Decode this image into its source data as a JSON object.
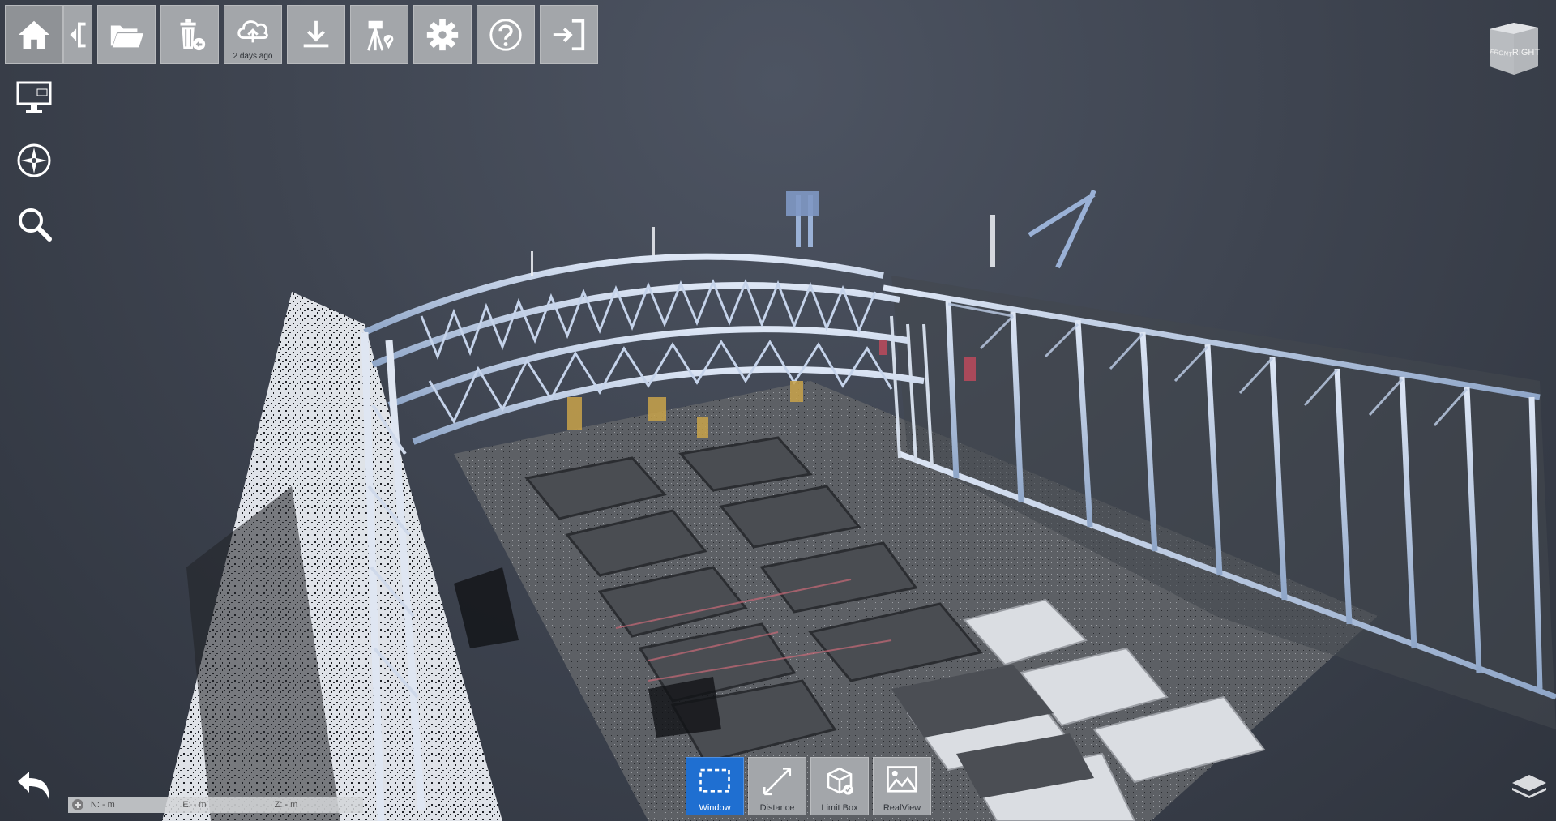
{
  "toolbar": {
    "home_icon": "home-icon",
    "collapse_icon": "collapse-panel-icon",
    "open_icon": "folder-open-icon",
    "delete_icon": "trash-restore-icon",
    "upload_icon": "cloud-upload-icon",
    "upload_caption": "2 days ago",
    "download_icon": "download-icon",
    "geo_icon": "survey-marker-icon",
    "settings_icon": "gear-icon",
    "help_icon": "help-icon",
    "exit_icon": "sign-in-icon"
  },
  "side": {
    "display_icon": "monitor-icon",
    "compass_icon": "compass-icon",
    "search_icon": "search-icon"
  },
  "viewcube": {
    "face_right": "RIGHT",
    "face_front": "FRONT"
  },
  "bottom_tools": [
    {
      "label": "Window",
      "icon": "selection-window-icon",
      "active": true
    },
    {
      "label": "Distance",
      "icon": "distance-measure-icon",
      "active": false
    },
    {
      "label": "Limit Box",
      "icon": "limit-box-icon",
      "active": false
    },
    {
      "label": "RealView",
      "icon": "realview-icon",
      "active": false
    }
  ],
  "coordinates": {
    "n": "N: - m",
    "e": "E: - m",
    "z": "Z: - m"
  },
  "colors": {
    "accent": "#1f6fd1",
    "toolbar": "#a3a6aa",
    "background": "#3f4551"
  }
}
